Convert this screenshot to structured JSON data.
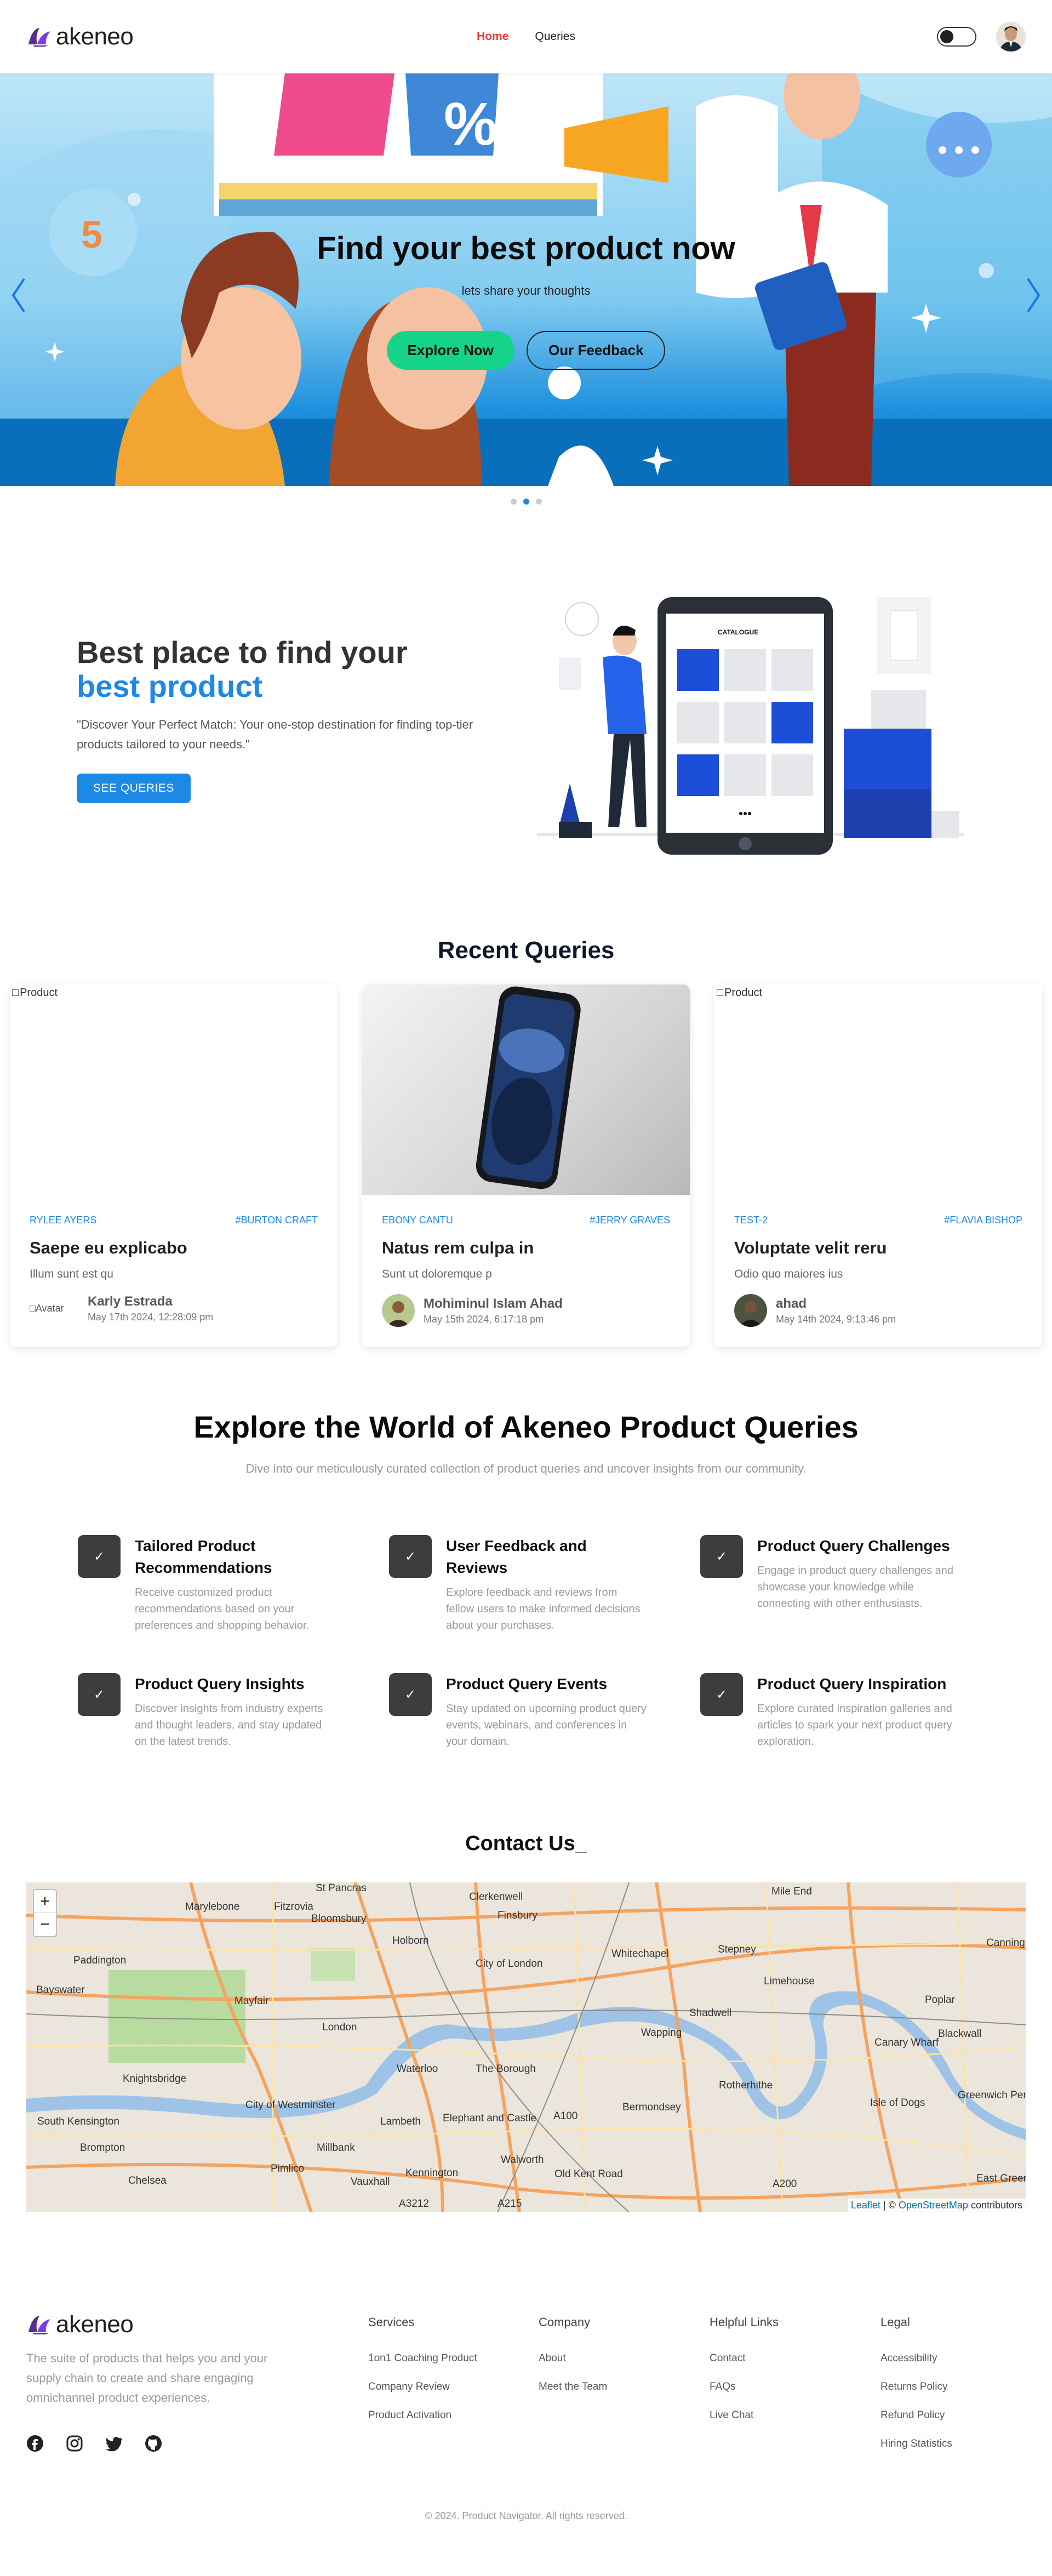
{
  "nav": {
    "brand": "akeneo",
    "links": [
      {
        "label": "Home",
        "active": true
      },
      {
        "label": "Queries",
        "active": false
      }
    ]
  },
  "hero": {
    "title": "Find your best product now",
    "subtitle": "lets share your thoughts",
    "primary_button": "Explore Now",
    "secondary_button": "Our Feedback",
    "slide_count": 3,
    "active_slide": 2
  },
  "about": {
    "title_line1": "Best place to find your",
    "title_line2": "best product",
    "description": "\"Discover Your Perfect Match: Your one-stop destination for finding top-tier products tailored to your needs.\"",
    "button": "SEE QUERIES",
    "illustration_label": "CATALOGUE"
  },
  "recent": {
    "title": "Recent Queries",
    "cards": [
      {
        "image_alt": "Product",
        "image_broken": true,
        "brand": "RYLEE AYERS",
        "tag": "#BURTON CRAFT",
        "title": "Saepe eu explicabo",
        "desc": "Illum sunt est qu",
        "avatar_alt": "Avatar",
        "user": "Karly Estrada",
        "date": "May 17th 2024, 12:28:09 pm"
      },
      {
        "image_alt": "Product",
        "image_broken": false,
        "brand": "EBONY CANTU",
        "tag": "#JERRY GRAVES",
        "title": "Natus rem culpa in",
        "desc": "Sunt ut doloremque p",
        "avatar_alt": "",
        "user": "Mohiminul Islam Ahad",
        "date": "May 15th 2024, 6:17:18 pm"
      },
      {
        "image_alt": "Product",
        "image_broken": true,
        "brand": "TEST-2",
        "tag": "#FLAVIA BISHOP",
        "title": "Voluptate velit reru",
        "desc": "Odio quo maiores ius",
        "avatar_alt": "",
        "user": "ahad",
        "date": "May 14th 2024, 9:13:46 pm"
      }
    ]
  },
  "explore": {
    "title": "Explore the World of Akeneo Product Queries",
    "subtitle": "Dive into our meticulously curated collection of product queries and uncover insights from our community.",
    "features": [
      {
        "title": "Tailored Product Recommendations",
        "desc": "Receive customized product recommendations based on your preferences and shopping behavior."
      },
      {
        "title": "User Feedback and Reviews",
        "desc": "Explore feedback and reviews from fellow users to make informed decisions about your purchases."
      },
      {
        "title": "Product Query Challenges",
        "desc": "Engage in product query challenges and showcase your knowledge while connecting with other enthusiasts."
      },
      {
        "title": "Product Query Insights",
        "desc": "Discover insights from industry experts and thought leaders, and stay updated on the latest trends."
      },
      {
        "title": "Product Query Events",
        "desc": "Stay updated on upcoming product query events, webinars, and conferences in your domain."
      },
      {
        "title": "Product Query Inspiration",
        "desc": "Explore curated inspiration galleries and articles to spark your next product query exploration."
      }
    ]
  },
  "contact": {
    "title": "Contact Us_",
    "zoom_in": "+",
    "zoom_out": "−",
    "attribution_leaflet": "Leaflet",
    "attribution_sep": " | © ",
    "attribution_osm": "OpenStreetMap",
    "attribution_tail": " contributors",
    "places": [
      "St Pancras",
      "Clerkenwell",
      "Marylebone",
      "Fitzrovia",
      "Bloomsbury",
      "Holborn",
      "Finsbury",
      "Mile End",
      "Canning",
      "Paddington",
      "Bayswater",
      "Mayfair",
      "City of London",
      "Whitechapel",
      "Stepney",
      "Limehouse",
      "Poplar",
      "London",
      "Shadwell",
      "Blackwall",
      "Knightsbridge",
      "Wapping",
      "Canary Wharf",
      "Waterloo",
      "The Borough",
      "Rotherhithe",
      "Isle of Dogs",
      "City of Westminster",
      "South Kensington",
      "Lambeth",
      "Bermondsey",
      "Greenwich Peninsula",
      "Brompton",
      "Elephant and Castle",
      "Millbank",
      "Walworth",
      "Chelsea",
      "Pimlico",
      "Vauxhall",
      "Kennington",
      "Old Kent Road",
      "East Greenw",
      "A100",
      "A200",
      "A215",
      "A3212"
    ]
  },
  "footer": {
    "brand": "akeneo",
    "desc": "The suite of products that helps you and your supply chain to create and share engaging omnichannel product experiences.",
    "socials": [
      "facebook-icon",
      "instagram-icon",
      "twitter-icon",
      "github-icon"
    ],
    "columns": [
      {
        "title": "Services",
        "links": [
          "1on1 Coaching Product",
          "Company Review",
          "Product Activation"
        ]
      },
      {
        "title": "Company",
        "links": [
          "About",
          "Meet the Team"
        ]
      },
      {
        "title": "Helpful Links",
        "links": [
          "Contact",
          "FAQs",
          "Live Chat"
        ]
      },
      {
        "title": "Legal",
        "links": [
          "Accessibility",
          "Returns Policy",
          "Refund Policy",
          "Hiring Statistics"
        ]
      }
    ],
    "copyright": "© 2024. Product Navigator. All rights reserved."
  },
  "colors": {
    "accent": "#1e88e5",
    "active_nav": "#ef3b3b",
    "explore_button": "#16d38a",
    "logo_purple": "#5b2d91"
  }
}
